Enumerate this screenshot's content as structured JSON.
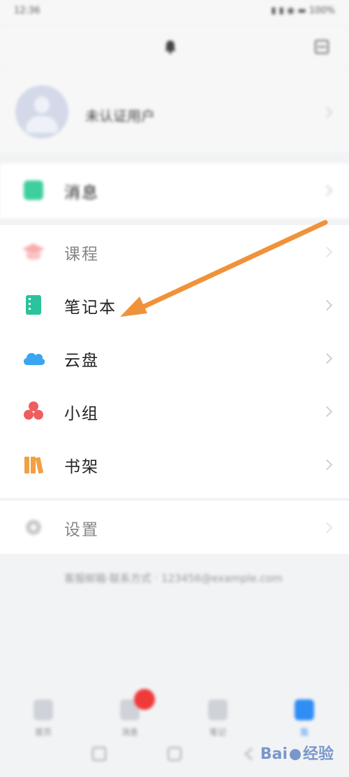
{
  "status_bar": {
    "time": "12:36",
    "right": "▮ ▮ ◉ ▬ 100%"
  },
  "top_bar": {
    "bell_icon": "bell-icon",
    "scan_icon": "scan-icon"
  },
  "profile": {
    "name": "未认证用户"
  },
  "menu": {
    "group1": [
      {
        "label": "消息",
        "icon": "message-icon",
        "color": "#3fcf9f"
      }
    ],
    "group2": [
      {
        "label": "课程",
        "icon": "course-icon",
        "color": "#f26b6b"
      },
      {
        "label": "笔记本",
        "icon": "notebook-icon",
        "color": "#2bc39b"
      },
      {
        "label": "云盘",
        "icon": "cloud-icon",
        "color": "#3aa5f0"
      },
      {
        "label": "小组",
        "icon": "group-icon",
        "color": "#ee5e5e"
      },
      {
        "label": "书架",
        "icon": "bookshelf-icon",
        "color": "#f0a045"
      }
    ],
    "group3": [
      {
        "label": "设置",
        "icon": "settings-icon",
        "color": "#9aa0a6"
      }
    ]
  },
  "footer": {
    "text": "客服邮箱·联系方式 · 123456@example.com"
  },
  "tabbar": {
    "tabs": [
      {
        "label": "首页"
      },
      {
        "label": "消息"
      },
      {
        "label": "笔记"
      },
      {
        "label": "我"
      }
    ],
    "active_color": "#2f8ef5",
    "badge_color": "#f03a3a"
  },
  "annotation": {
    "arrow_color": "#f0923a"
  },
  "watermark": {
    "text_left": "Bai",
    "text_right": "经验"
  }
}
